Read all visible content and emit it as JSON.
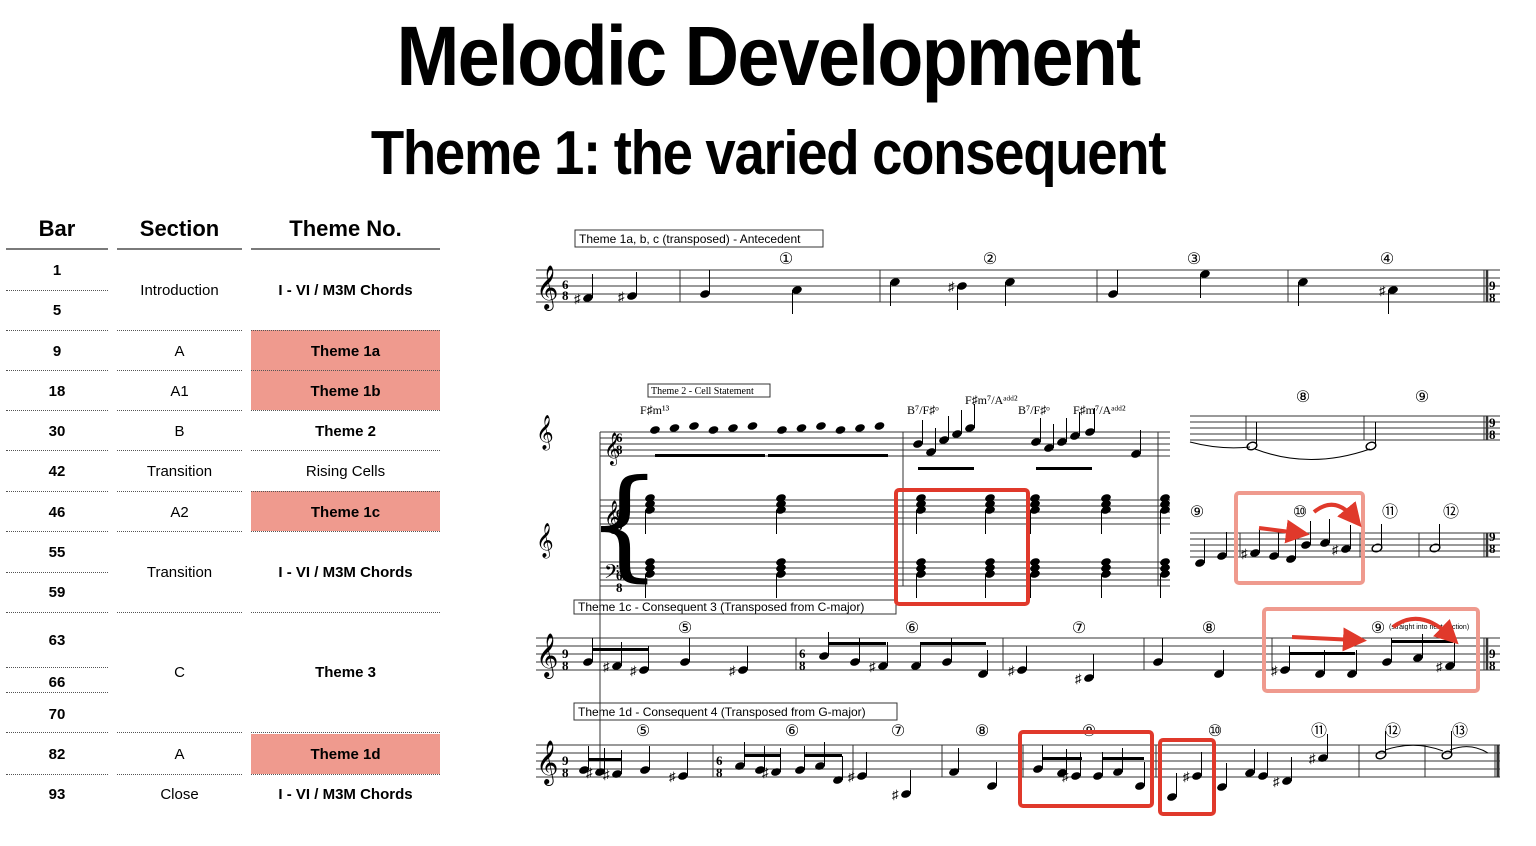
{
  "slide": {
    "title": "Melodic Development",
    "subtitle": "Theme 1: the varied consequent"
  },
  "table": {
    "headers": {
      "bar": "Bar",
      "section": "Section",
      "theme": "Theme No."
    },
    "bars": [
      "1",
      "5",
      "9",
      "18",
      "30",
      "42",
      "46",
      "55",
      "59",
      "63",
      "66",
      "70",
      "82",
      "93"
    ],
    "sections": [
      "Introduction",
      "A",
      "A1",
      "B",
      "Transition",
      "A2",
      "Transition",
      "C",
      "A",
      "Close"
    ],
    "themes": [
      "I - VI / M3M Chords",
      "Theme 1a",
      "Theme 1b",
      "Theme 2",
      "Rising Cells",
      "Theme 1c",
      "I - VI / M3M Chords",
      "Theme 3",
      "Theme 1d",
      "I - VI / M3M Chords"
    ],
    "highlight_color": "#ef9a8e"
  },
  "score": {
    "antecedent_label": "Theme 1a, b, c (transposed) - Antecedent",
    "antecedent_numbers": [
      "①",
      "②",
      "③",
      "④"
    ],
    "theme2_label": "Theme 2 - Cell Statement",
    "chords": [
      "F♯m¹³",
      "B⁷/F♯ᵒ",
      "F♯m⁷/Aᵃᵈᵈ²",
      "B⁷/F♯ᵒ",
      "F♯m⁷/Aᵃᵈᵈ²"
    ],
    "theme2_numbers": [
      "⑧",
      "⑨"
    ],
    "theme2b_numbers": [
      "⑨",
      "⑩",
      "⑪",
      "⑫"
    ],
    "consequent3_label": "Theme 1c - Consequent 3 (Transposed from C-major)",
    "consequent3_numbers": [
      "⑤",
      "⑥",
      "⑦",
      "⑧",
      "⑨"
    ],
    "consequent3_note": "(straight into next section)",
    "consequent4_label": "Theme 1d - Consequent 4 (Transposed from G-major)",
    "consequent4_numbers": [
      "⑤",
      "⑥",
      "⑦",
      "⑧",
      "⑨",
      "⑩",
      "⑪",
      "⑫",
      "⑬"
    ],
    "time_sig_68": [
      "6",
      "8"
    ],
    "time_sig_98": [
      "9",
      "8"
    ],
    "annotation_color": "#e0392b",
    "annotation_faded_color": "#ef9a8e"
  }
}
